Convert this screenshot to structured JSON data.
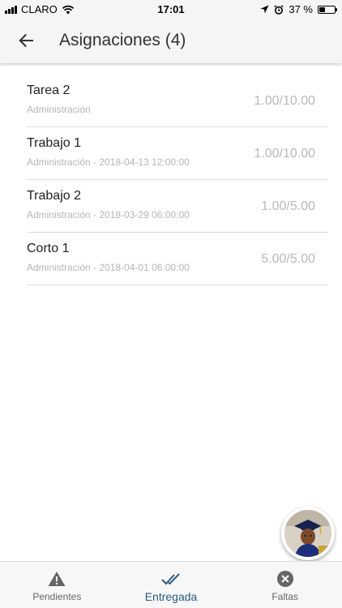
{
  "status_bar": {
    "carrier": "CLARO",
    "time": "17:01",
    "battery_text": "37 %",
    "battery_level": 0.37,
    "icons": [
      "signal-icon",
      "wifi-icon",
      "location-icon",
      "alarm-icon",
      "battery-icon"
    ]
  },
  "app_bar": {
    "back_icon": "arrow-back-icon",
    "title": "Asignaciones (4)"
  },
  "assignments": [
    {
      "title": "Tarea 2",
      "subtitle": "Administración",
      "score": "1.00/10.00"
    },
    {
      "title": "Trabajo 1",
      "subtitle": "Administración - 2018-04-13 12:00:00",
      "score": "1.00/10.00"
    },
    {
      "title": "Trabajo 2",
      "subtitle": "Administración - 2018-03-29 06:00:00",
      "score": "1.00/5.00"
    },
    {
      "title": "Corto 1",
      "subtitle": "Administración - 2018-04-01 06:00:00",
      "score": "5.00/5.00"
    }
  ],
  "bottom_nav": {
    "tabs": [
      {
        "label": "Pendientes",
        "icon": "warning-icon"
      },
      {
        "label": "Entregada",
        "icon": "double-check-icon",
        "active": true
      },
      {
        "label": "Faltas",
        "icon": "cancel-circle-icon"
      }
    ]
  },
  "colors": {
    "accent": "#2c5b7f",
    "bar_background": "#f5f5f5",
    "muted_text": "#b5b5b5"
  }
}
